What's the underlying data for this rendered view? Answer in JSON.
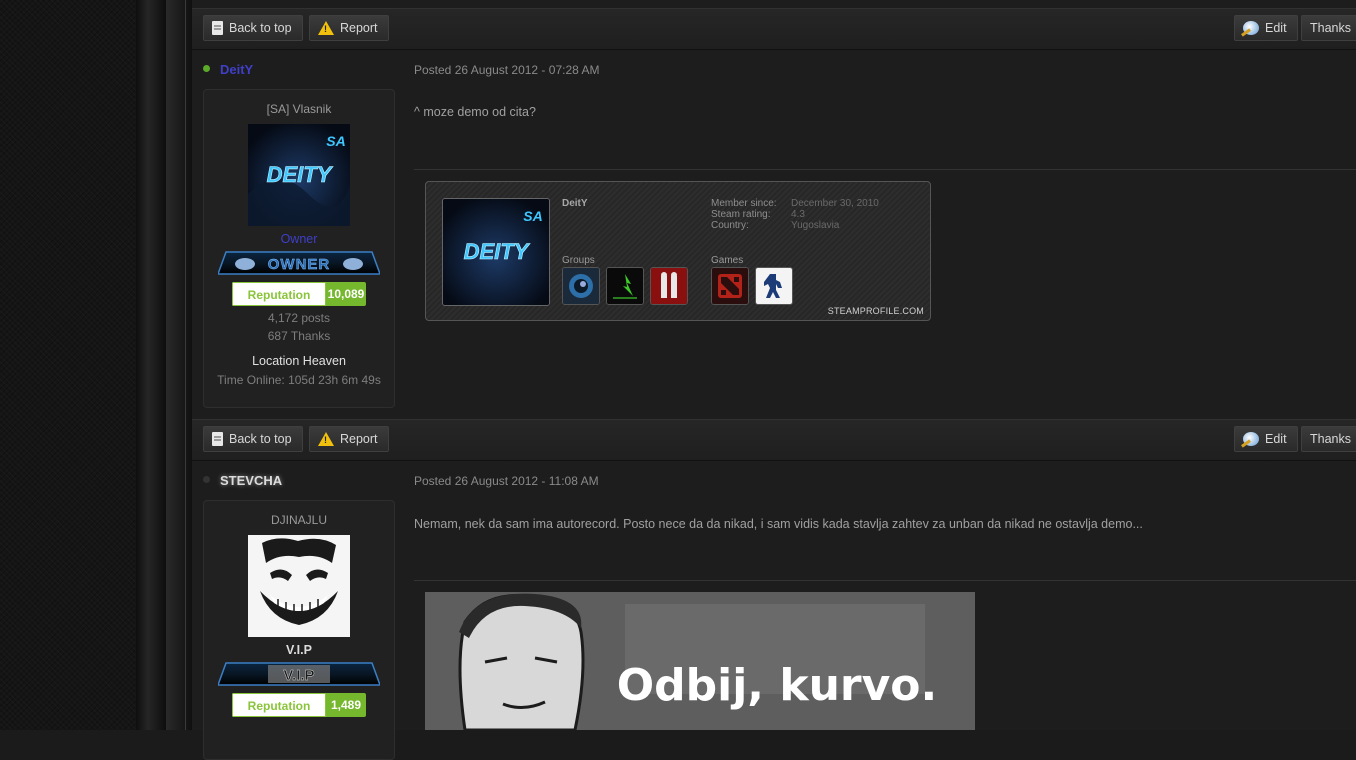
{
  "toolbar": {
    "back_to_top": "Back to top",
    "report": "Report",
    "edit": "Edit",
    "thanks": "Thanks"
  },
  "posts": [
    {
      "username": "DeitY",
      "username_color": "#3f3fc8",
      "online_color": "#5caa2a",
      "user_title": "[SA] Vlasnik",
      "group": "Owner",
      "group_color": "#3f3fc8",
      "rank_text": "OWNER",
      "reputation_label": "Reputation",
      "reputation_value": "10,089",
      "posts": "4,172 posts",
      "thanks": "687 Thanks",
      "location": "Location Heaven",
      "time_online": "Time Online: 105d 23h 6m 49s",
      "posted": "Posted 26 August 2012 - 07:28 AM",
      "body": "^ moze demo od cita?",
      "avatar_text": "DEITY",
      "steam": {
        "name": "DeitY",
        "member_since_label": "Member since:",
        "member_since": "December 30, 2010",
        "rating_label": "Steam rating:",
        "rating": "4.3",
        "country_label": "Country:",
        "country": "Yugoslavia",
        "groups_label": "Groups",
        "games_label": "Games",
        "footer": "STEAMPROFILE.COM"
      }
    },
    {
      "username": "STEVCHA",
      "username_color": "#dcdcdc",
      "online_color": "#333333",
      "user_title": "DJINAJLU",
      "group": "V.I.P",
      "group_color": "#dcdcdc",
      "rank_text": "V.I.P",
      "reputation_label": "Reputation",
      "reputation_value": "1,489",
      "posted": "Posted 26 August 2012 - 11:08 AM",
      "body": "Nemam, nek da sam ima autorecord. Posto nece da da nikad, i sam vidis kada stavlja zahtev za unban da nikad ne ostavlja demo...",
      "meme_text": "Odbij, kurvo."
    }
  ]
}
